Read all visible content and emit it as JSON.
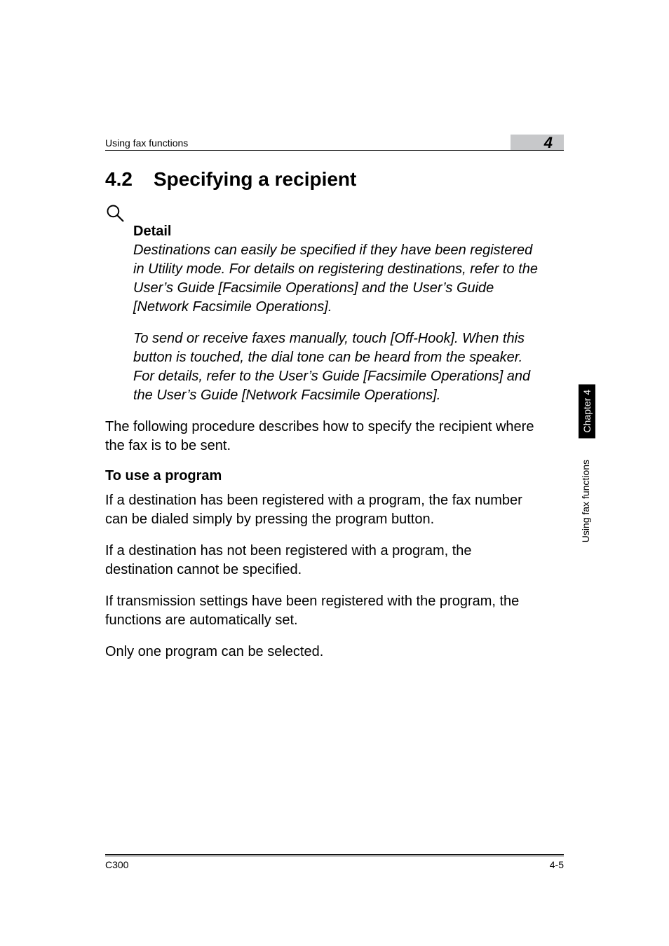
{
  "runningHead": {
    "text": "Using fax functions",
    "badge": "4"
  },
  "section": {
    "number": "4.2",
    "title": "Specifying a recipient"
  },
  "detail": {
    "label": "Detail",
    "para1": "Destinations can easily be specified if they have been registered in Utility mode. For details on registering destinations, refer to the User’s Guide [Facsimile Operations] and the User’s Guide [Network Facsimile Operations].",
    "para2": "To send or receive faxes manually, touch [Off-Hook]. When this button is touched, the dial tone can be heard from the speaker. For details, refer to the User’s Guide [Facsimile Operations] and the User’s Guide [Network Facsimile Operations]."
  },
  "intro": "The following procedure describes how to specify the recipient where the fax is to be sent.",
  "subsection": {
    "heading": "To use a program",
    "p1": "If a destination has been registered with a program, the fax number can be dialed simply by pressing the program button.",
    "p2": "If a destination has not been registered with a program, the destination cannot be specified.",
    "p3": "If transmission settings have been registered with the program, the functions are automatically set.",
    "p4": "Only one program can be selected."
  },
  "footer": {
    "left": "C300",
    "right": "4-5"
  },
  "sideTab": "Chapter 4",
  "sideLabel": "Using fax functions"
}
